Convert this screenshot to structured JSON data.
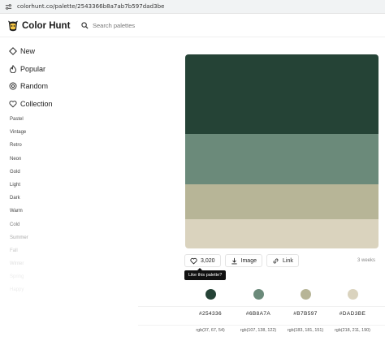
{
  "browser": {
    "url": "colorhunt.co/palette/2543366b8a7ab7b597dad3be"
  },
  "header": {
    "brand": "Color Hunt",
    "search_placeholder": "Search palettes"
  },
  "sidebar": {
    "nav": [
      {
        "label": "New",
        "icon": "diamond-icon"
      },
      {
        "label": "Popular",
        "icon": "fire-icon"
      },
      {
        "label": "Random",
        "icon": "random-icon"
      },
      {
        "label": "Collection",
        "icon": "heart-icon"
      }
    ],
    "categories": [
      "Pastel",
      "Vintage",
      "Retro",
      "Neon",
      "Gold",
      "Light",
      "Dark",
      "Warm",
      "Cold",
      "Summer",
      "Fall",
      "Winter",
      "Spring",
      "Happy"
    ]
  },
  "palette": {
    "colors": [
      {
        "hex": "#254336",
        "label": "#254336",
        "rgb": "rgb(37, 67, 54)"
      },
      {
        "hex": "#6B8A7A",
        "label": "#6B8A7A",
        "rgb": "rgb(107, 138, 122)"
      },
      {
        "hex": "#B7B597",
        "label": "#B7B597",
        "rgb": "rgb(183, 181, 151)"
      },
      {
        "hex": "#DAD3BE",
        "label": "#DAD3BE",
        "rgb": "rgb(218, 211, 190)"
      }
    ],
    "likes": "3,020",
    "image_label": "Image",
    "link_label": "Link",
    "age": "3 weeks",
    "tooltip": "Like this palette?"
  }
}
